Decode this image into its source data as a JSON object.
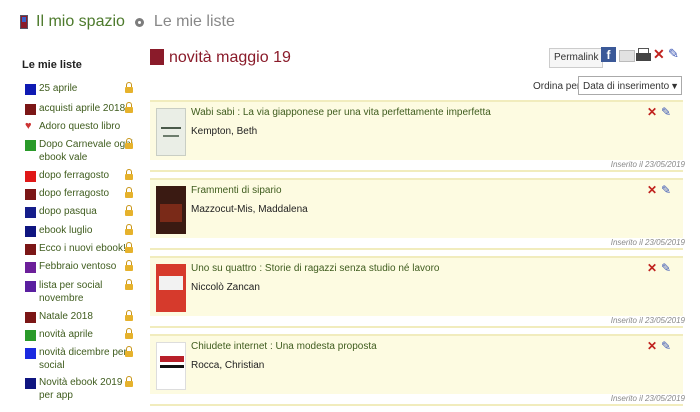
{
  "breadcrumb": {
    "home": "Il mio spazio",
    "current": "Le mie liste"
  },
  "sidebar": {
    "heading": "Le mie liste",
    "items": [
      {
        "label": "25 aprile",
        "color": "#0f1ab3",
        "locked": true
      },
      {
        "label": "acquisti aprile 2018",
        "color": "#7b1616",
        "locked": true
      },
      {
        "label": "Adoro questo libro",
        "icon": "heart-icon",
        "locked": false
      },
      {
        "label": "Dopo Carnevale ogni ebook vale",
        "color": "#2a9a2a",
        "locked": true
      },
      {
        "label": "dopo ferragosto",
        "color": "#e01818",
        "locked": true
      },
      {
        "label": "dopo ferragosto",
        "color": "#7b1616",
        "locked": true
      },
      {
        "label": "dopo pasqua",
        "color": "#151d8a",
        "locked": true
      },
      {
        "label": "ebook luglio",
        "color": "#0f1580",
        "locked": true
      },
      {
        "label": "Ecco i nuovi ebook!",
        "color": "#7b1616",
        "locked": true
      },
      {
        "label": "Febbraio ventoso",
        "color": "#6c1f9a",
        "locked": true
      },
      {
        "label": "lista per social novembre",
        "color": "#5a1fa0",
        "locked": true
      },
      {
        "label": "Natale 2018",
        "color": "#7b1616",
        "locked": true
      },
      {
        "label": "novità aprile",
        "color": "#2a9a2a",
        "locked": true
      },
      {
        "label": "novità dicembre per social",
        "color": "#1a2ae0",
        "locked": true
      },
      {
        "label": "Novità ebook 2019 per app",
        "color": "#0f1580",
        "locked": true
      }
    ]
  },
  "list": {
    "title": "novità maggio 19",
    "color": "#8a1b2a",
    "permalink_label": "Permalink",
    "share_icons": [
      "facebook-icon",
      "mail-icon",
      "print-icon",
      "delete-icon",
      "edit-icon"
    ],
    "sort": {
      "label": "Ordina per",
      "selected": "Data di inserimento"
    },
    "records": [
      {
        "title": "Wabi sabi : La via giapponese per una vita perfettamente imperfetta",
        "author": "Kempton, Beth",
        "date": "Inserito il 23/05/2019",
        "cover": "cover-light"
      },
      {
        "title": "Frammenti di sipario",
        "author": "Mazzocut-Mis, Maddalena",
        "date": "Inserito il 23/05/2019",
        "cover": "cover-dark"
      },
      {
        "title": "Uno su quattro : Storie di ragazzi senza studio né lavoro",
        "author": "Niccolò Zancan",
        "date": "Inserito il 23/05/2019",
        "cover": "cover-red"
      },
      {
        "title": "Chiudete internet : Una modesta proposta",
        "author": "Rocca, Christian",
        "date": "Inserito il 23/05/2019",
        "cover": "cover-white"
      }
    ]
  }
}
